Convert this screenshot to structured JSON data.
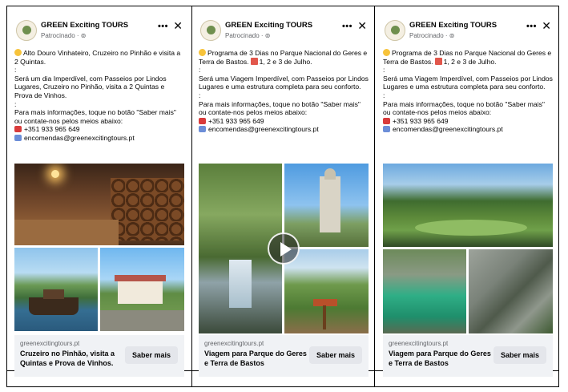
{
  "posts": [
    {
      "page_name": "GREEN Exciting TOURS",
      "sponsored": "Patrocinado · ⊚",
      "line1": "Alto Douro Vinhateiro, Cruzeiro no Pinhão e visita a 2 Quintas.",
      "dot1": ":",
      "line2": "Será um dia Imperdível, com Passeios por Lindos Lugares, Cruzeiro no Pinhão, visita a 2 Quintas e Prova de Vinhos.",
      "dot2": ":",
      "line3": "Para mais informações, toque no botão \"Saber mais\" ou contate-nos pelos meios abaixo:",
      "phone": "+351 933 965 649",
      "email": "encomendas@greenexcitingtours.pt",
      "domain": "greenexcitingtours.pt",
      "headline": "Cruzeiro no Pinhão, visita a Quintas e Prova de Vinhos.",
      "button": "Saber mais"
    },
    {
      "page_name": "GREEN Exciting TOURS",
      "sponsored": "Patrocinado · ⊚",
      "line1a": "Programa de 3 Dias no Parque Nacional do Geres e Terra de Bastos.",
      "line1b": "1, 2 e 3 de Julho.",
      "dot1": ":",
      "line2": "Será uma Viagem Imperdível, com Passeios por Lindos Lugares e uma estrutura completa para seu conforto.",
      "dot2": ":",
      "line3": "Para mais informações, toque no botão \"Saber mais\" ou contate-nos pelos meios abaixo:",
      "phone": "+351 933 965 649",
      "email": "encomendas@greenexcitingtours.pt",
      "domain": "greenexcitingtours.pt",
      "headline": "Viagem para Parque do Geres e Terra de Bastos",
      "button": "Saber mais"
    },
    {
      "page_name": "GREEN Exciting TOURS",
      "sponsored": "Patrocinado · ⊚",
      "line1a": "Programa de 3 Dias no Parque Nacional do Geres e Terra de Bastos.",
      "line1b": "1, 2 e 3 de Julho.",
      "dot1": ":",
      "line2": "Será uma Viagem Imperdível, com Passeios por Lindos Lugares e uma estrutura completa para seu conforto.",
      "dot2": ":",
      "line3": "Para mais informações, toque no botão \"Saber mais\" ou contate-nos pelos meios abaixo:",
      "phone": "+351 933 965 649",
      "email": "encomendas@greenexcitingtours.pt",
      "domain": "greenexcitingtours.pt",
      "headline": "Viagem para Parque do Geres e Terra de Bastos",
      "button": "Saber mais"
    }
  ],
  "icons": {
    "more": "more-options-icon",
    "close": "close-icon",
    "phone": "telephone-icon",
    "email": "email-icon",
    "emoji": "smiling-face-icon",
    "calendar": "calendar-icon",
    "play": "play-icon"
  }
}
